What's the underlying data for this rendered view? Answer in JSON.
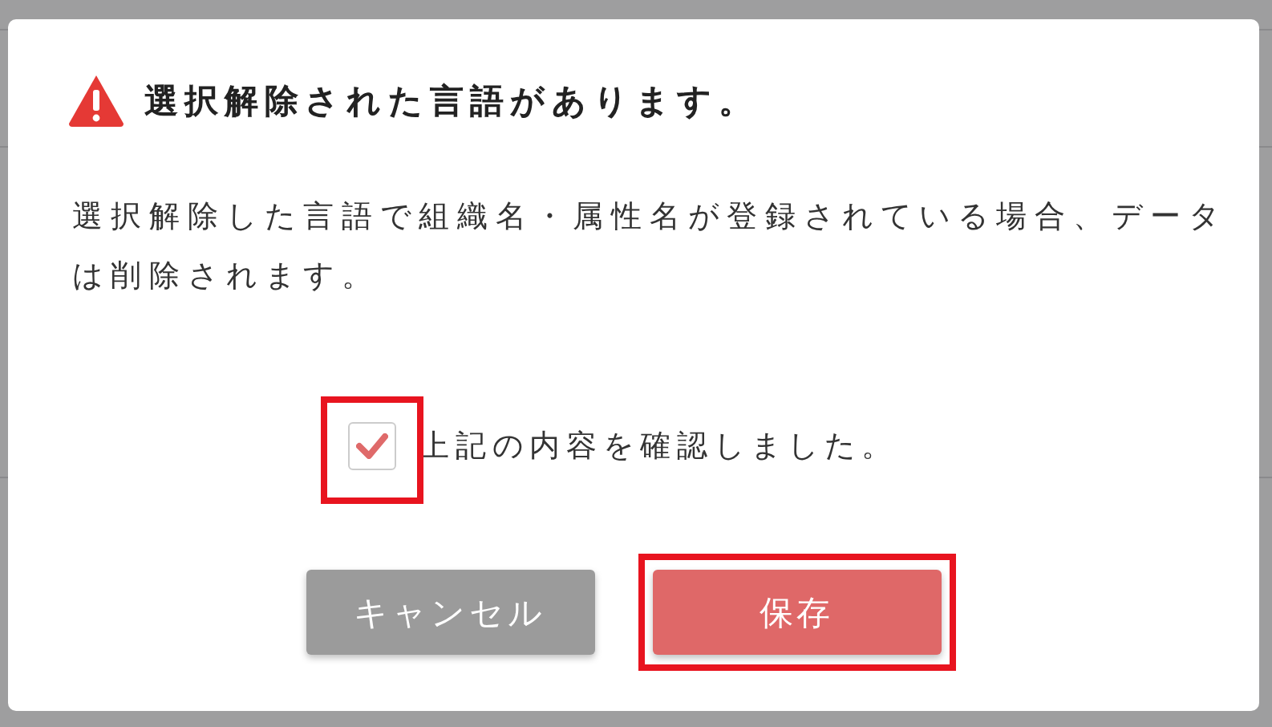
{
  "dialog": {
    "title": "選択解除された言語があります。",
    "message": "選択解除した言語で組織名・属性名が登録されている場合、データは削除されます。",
    "confirm": {
      "label": "上記の内容を確認しました。",
      "checked": true,
      "highlighted": true
    },
    "buttons": [
      {
        "label": "キャンセル",
        "kind": "secondary",
        "highlighted": false
      },
      {
        "label": "保存",
        "kind": "primary",
        "highlighted": true
      }
    ]
  }
}
